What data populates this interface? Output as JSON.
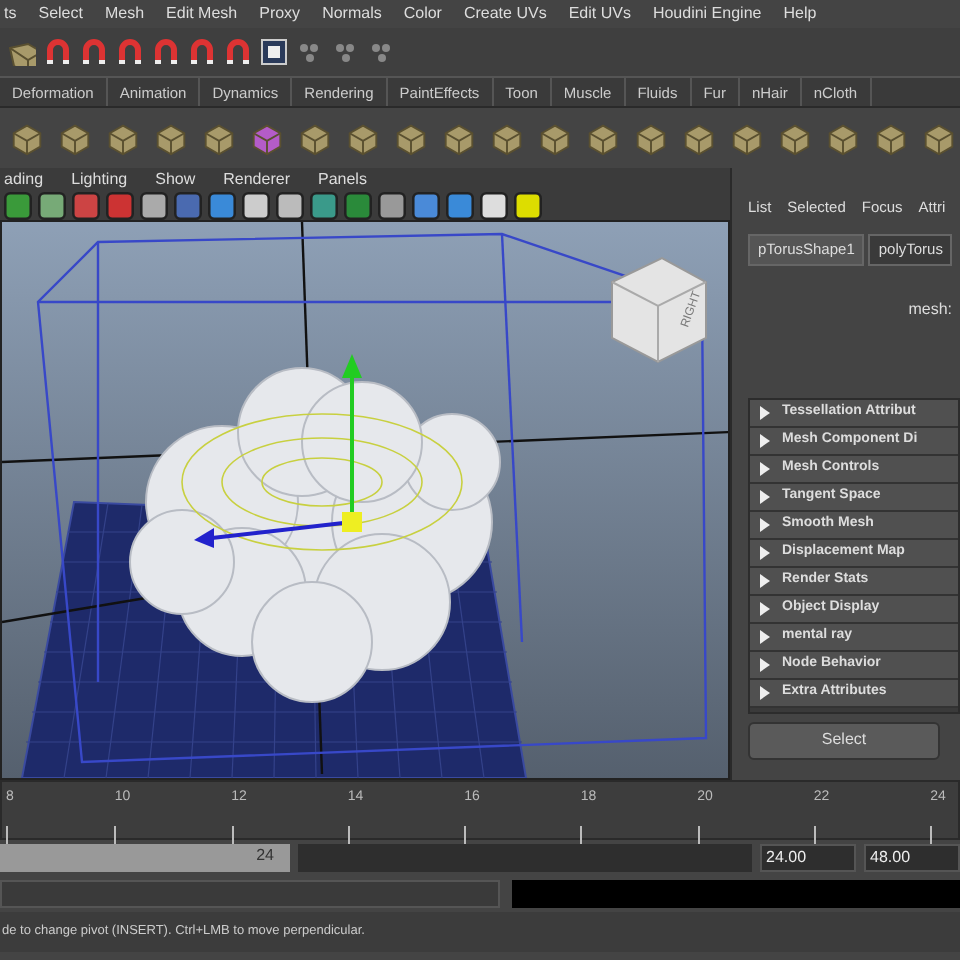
{
  "menu_bar": [
    "ts",
    "Select",
    "Mesh",
    "Edit Mesh",
    "Proxy",
    "Normals",
    "Color",
    "Create UVs",
    "Edit UVs",
    "Houdini Engine",
    "Help"
  ],
  "shelf_tabs": [
    "Deformation",
    "Animation",
    "Dynamics",
    "Rendering",
    "PaintEffects",
    "Toon",
    "Muscle",
    "Fluids",
    "Fur",
    "nHair",
    "nCloth"
  ],
  "panel_menu": [
    "ading",
    "Lighting",
    "Show",
    "Renderer",
    "Panels"
  ],
  "viewport": {
    "view_cube_label": "RIGHT"
  },
  "attribute_editor": {
    "menu": [
      "List",
      "Selected",
      "Focus",
      "Attri"
    ],
    "tabs": [
      {
        "label": "pTorusShape1",
        "selected": true
      },
      {
        "label": "polyTorus",
        "selected": false
      }
    ],
    "node_label": "mesh:",
    "sections": [
      "Tessellation Attribut",
      "Mesh Component Di",
      "Mesh Controls",
      "Tangent Space",
      "Smooth Mesh",
      "Displacement Map",
      "Render Stats",
      "Object Display",
      "mental ray",
      "Node Behavior",
      "Extra Attributes"
    ],
    "select_button": "Select"
  },
  "time_slider": {
    "ticks": [
      "8",
      "10",
      "12",
      "14",
      "16",
      "18",
      "20",
      "22",
      "24"
    ]
  },
  "range_slider": {
    "current": "24",
    "start": "24.00",
    "end": "48.00"
  },
  "help_line": "de to change pivot (INSERT).  Ctrl+LMB to move perpendicular."
}
